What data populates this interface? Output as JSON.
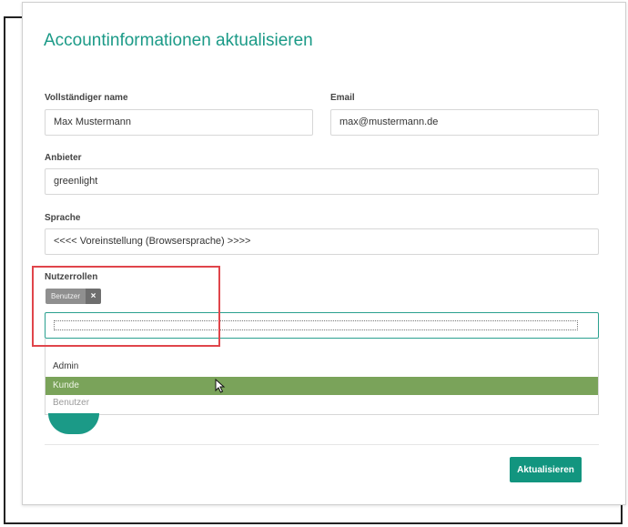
{
  "page": {
    "title": "Accountinformationen aktualisieren"
  },
  "fields": {
    "full_name": {
      "label": "Vollständiger name",
      "value": "Max Mustermann"
    },
    "email": {
      "label": "Email",
      "value": "max@mustermann.de"
    },
    "provider": {
      "label": "Anbieter",
      "value": "greenlight"
    },
    "language": {
      "label": "Sprache",
      "value": "<<<< Voreinstellung (Browsersprache) >>>>"
    }
  },
  "roles": {
    "label": "Nutzerrollen",
    "selected": [
      {
        "label": "Benutzer",
        "remove_symbol": "×"
      }
    ],
    "input_value": "",
    "options": [
      "Admin",
      "Kunde",
      "Benutzer"
    ],
    "active_option": "Kunde"
  },
  "actions": {
    "update_label": "Aktualisieren"
  },
  "colors": {
    "accent": "#1b9a87",
    "button": "#12957f",
    "option_hover": "#7aa35a",
    "annotation": "#e0454b"
  },
  "icons": {
    "chip_remove": "close-icon",
    "cursor": "mouse-pointer-icon"
  }
}
